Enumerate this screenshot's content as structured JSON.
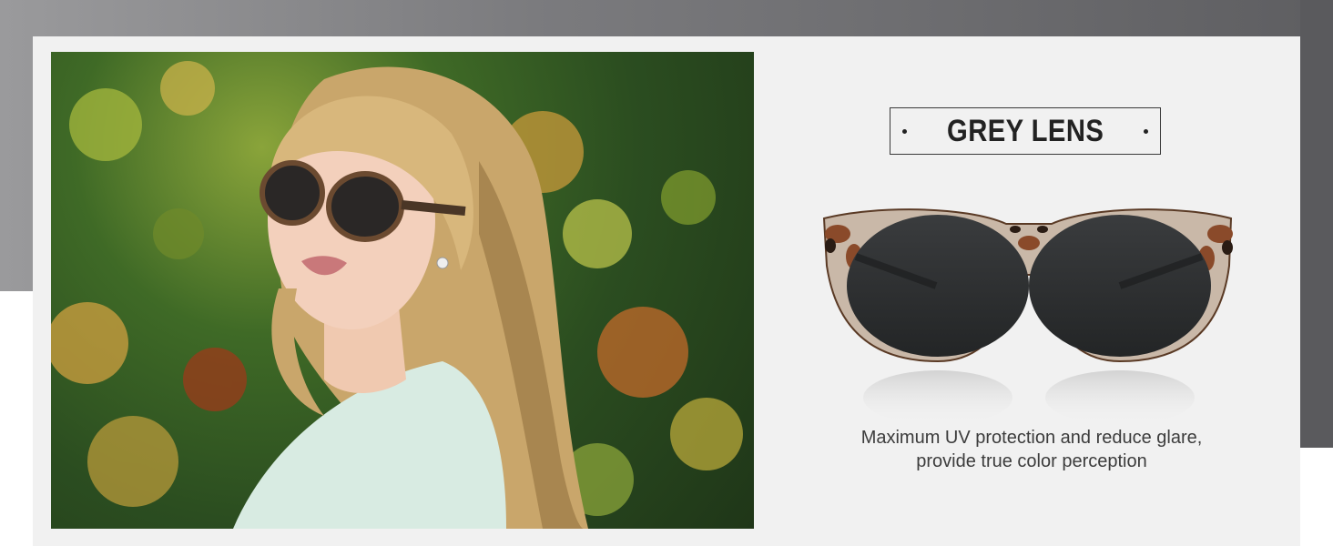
{
  "feature": {
    "title": "GREY LENS",
    "description_line1": "Maximum UV protection and reduce glare,",
    "description_line2": "provide true color perception"
  },
  "colors": {
    "background_band": "#7b7b7e",
    "card": "#f1f1f1",
    "title_text": "#222222",
    "caption_text": "#3c3c3c",
    "lens": "#2f3133",
    "frame_tortoise": "#8a4a2a"
  },
  "images": {
    "lifestyle_photo": "woman-wearing-sunglasses-photo",
    "product_image": "tortoise-fitover-sunglasses-image"
  }
}
